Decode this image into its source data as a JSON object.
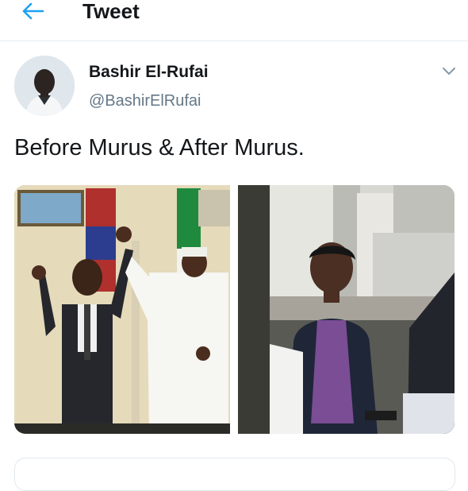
{
  "header": {
    "title": "Tweet",
    "back_icon": "arrow-left-icon",
    "accent": "#1da1f2"
  },
  "tweet": {
    "author_name": "Bashir El-Rufai",
    "author_handle": "@BashirElRufai",
    "text": "Before Murus & After Murus.",
    "menu_icon": "chevron-down-icon",
    "media": [
      {
        "name": "photo-before"
      },
      {
        "name": "photo-after"
      }
    ]
  },
  "colors": {
    "text": "#14171a",
    "secondary": "#657786",
    "border": "#e6ecf0"
  }
}
